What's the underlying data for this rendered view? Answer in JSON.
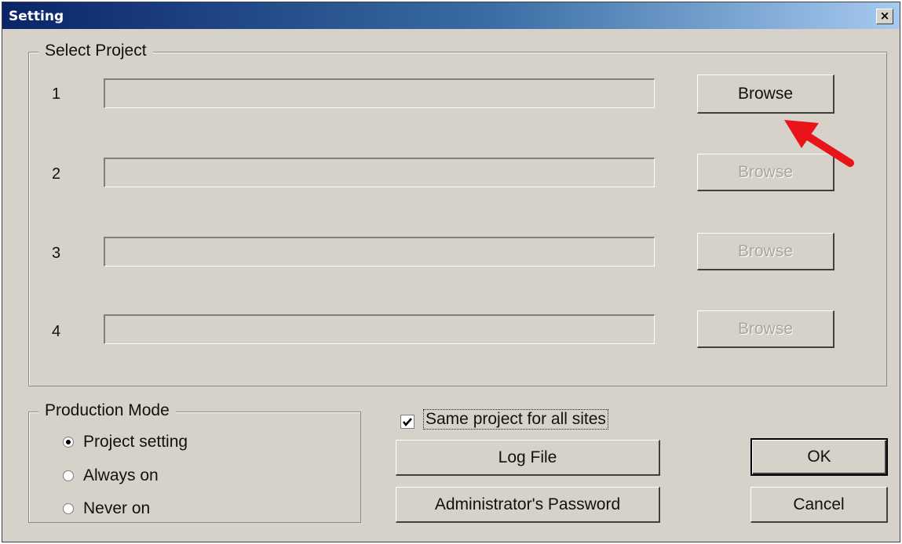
{
  "window": {
    "title": "Setting",
    "close_glyph": "×"
  },
  "select_project": {
    "legend": "Select Project",
    "rows": [
      {
        "num": "1",
        "value": "",
        "browse_label": "Browse",
        "browse_enabled": true
      },
      {
        "num": "2",
        "value": "",
        "browse_label": "Browse",
        "browse_enabled": false
      },
      {
        "num": "3",
        "value": "",
        "browse_label": "Browse",
        "browse_enabled": false
      },
      {
        "num": "4",
        "value": "",
        "browse_label": "Browse",
        "browse_enabled": false
      }
    ]
  },
  "production_mode": {
    "legend": "Production Mode",
    "options": [
      {
        "label": "Project setting",
        "selected": true
      },
      {
        "label": "Always on",
        "selected": false
      },
      {
        "label": "Never on",
        "selected": false
      }
    ]
  },
  "options": {
    "same_project_label": "Same project for all sites",
    "same_project_checked": true,
    "log_file_label": "Log File",
    "admin_password_label": "Administrator's Password"
  },
  "actions": {
    "ok_label": "OK",
    "cancel_label": "Cancel"
  },
  "annotation": {
    "arrow_color": "#e8141a"
  },
  "colors": {
    "dialog_face": "#d6d2ca",
    "title_gradient_start": "#0a246a",
    "title_gradient_end": "#a6caf0"
  }
}
